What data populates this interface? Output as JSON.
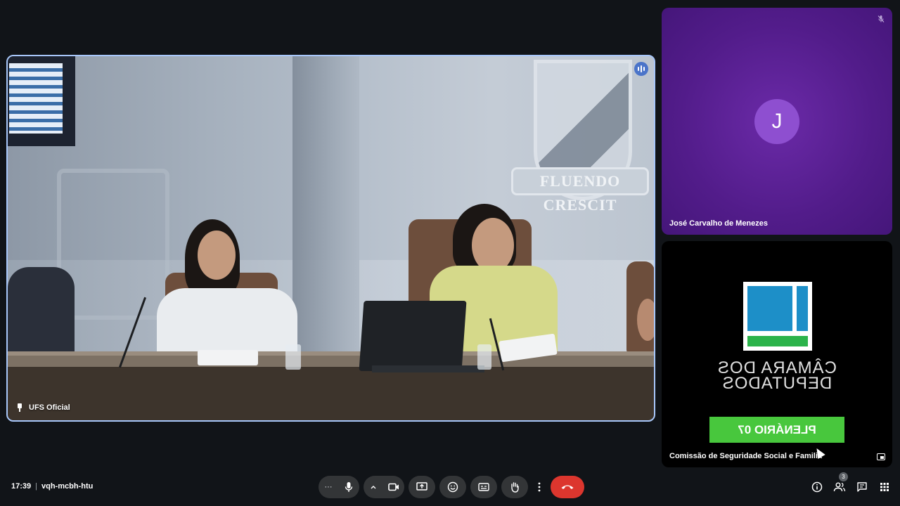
{
  "main_tile": {
    "label": "UFS Oficial",
    "pin_icon": "pin-icon",
    "speaking_icon": "audio-level-icon",
    "scene_motto": "FLUENDO CRESCIT"
  },
  "participants": [
    {
      "name": "José Carvalho de Menezes",
      "avatar_letter": "J",
      "muted": true
    },
    {
      "name": "Comissão de Seguridade Social e Familia",
      "screen_text": "CÂMARA DOS DEPUTADOS",
      "banner": "PLENÁRIO 07"
    }
  ],
  "meeting": {
    "time": "17:39",
    "code": "vqh-mcbh-htu"
  },
  "controls": {
    "more_options_label": "···",
    "mic_icon": "microphone-icon",
    "camera_icon": "video-camera-icon",
    "present_icon": "present-screen-icon",
    "emoji_icon": "emoji-icon",
    "captions_icon": "captions-icon",
    "raise_hand_icon": "raise-hand-icon",
    "more_icon": "more-vertical-icon",
    "end_call_icon": "end-call-icon"
  },
  "side_panel": {
    "people_count": "3",
    "info_icon": "info-icon",
    "people_icon": "people-icon",
    "chat_icon": "chat-icon",
    "activities_icon": "apps-grid-icon"
  },
  "colors": {
    "background": "#111418",
    "tile_border_active": "#a8c7fa",
    "avatar_tile": "#521c8a",
    "end_call": "#dc362e",
    "plenario_green": "#48c73d"
  }
}
